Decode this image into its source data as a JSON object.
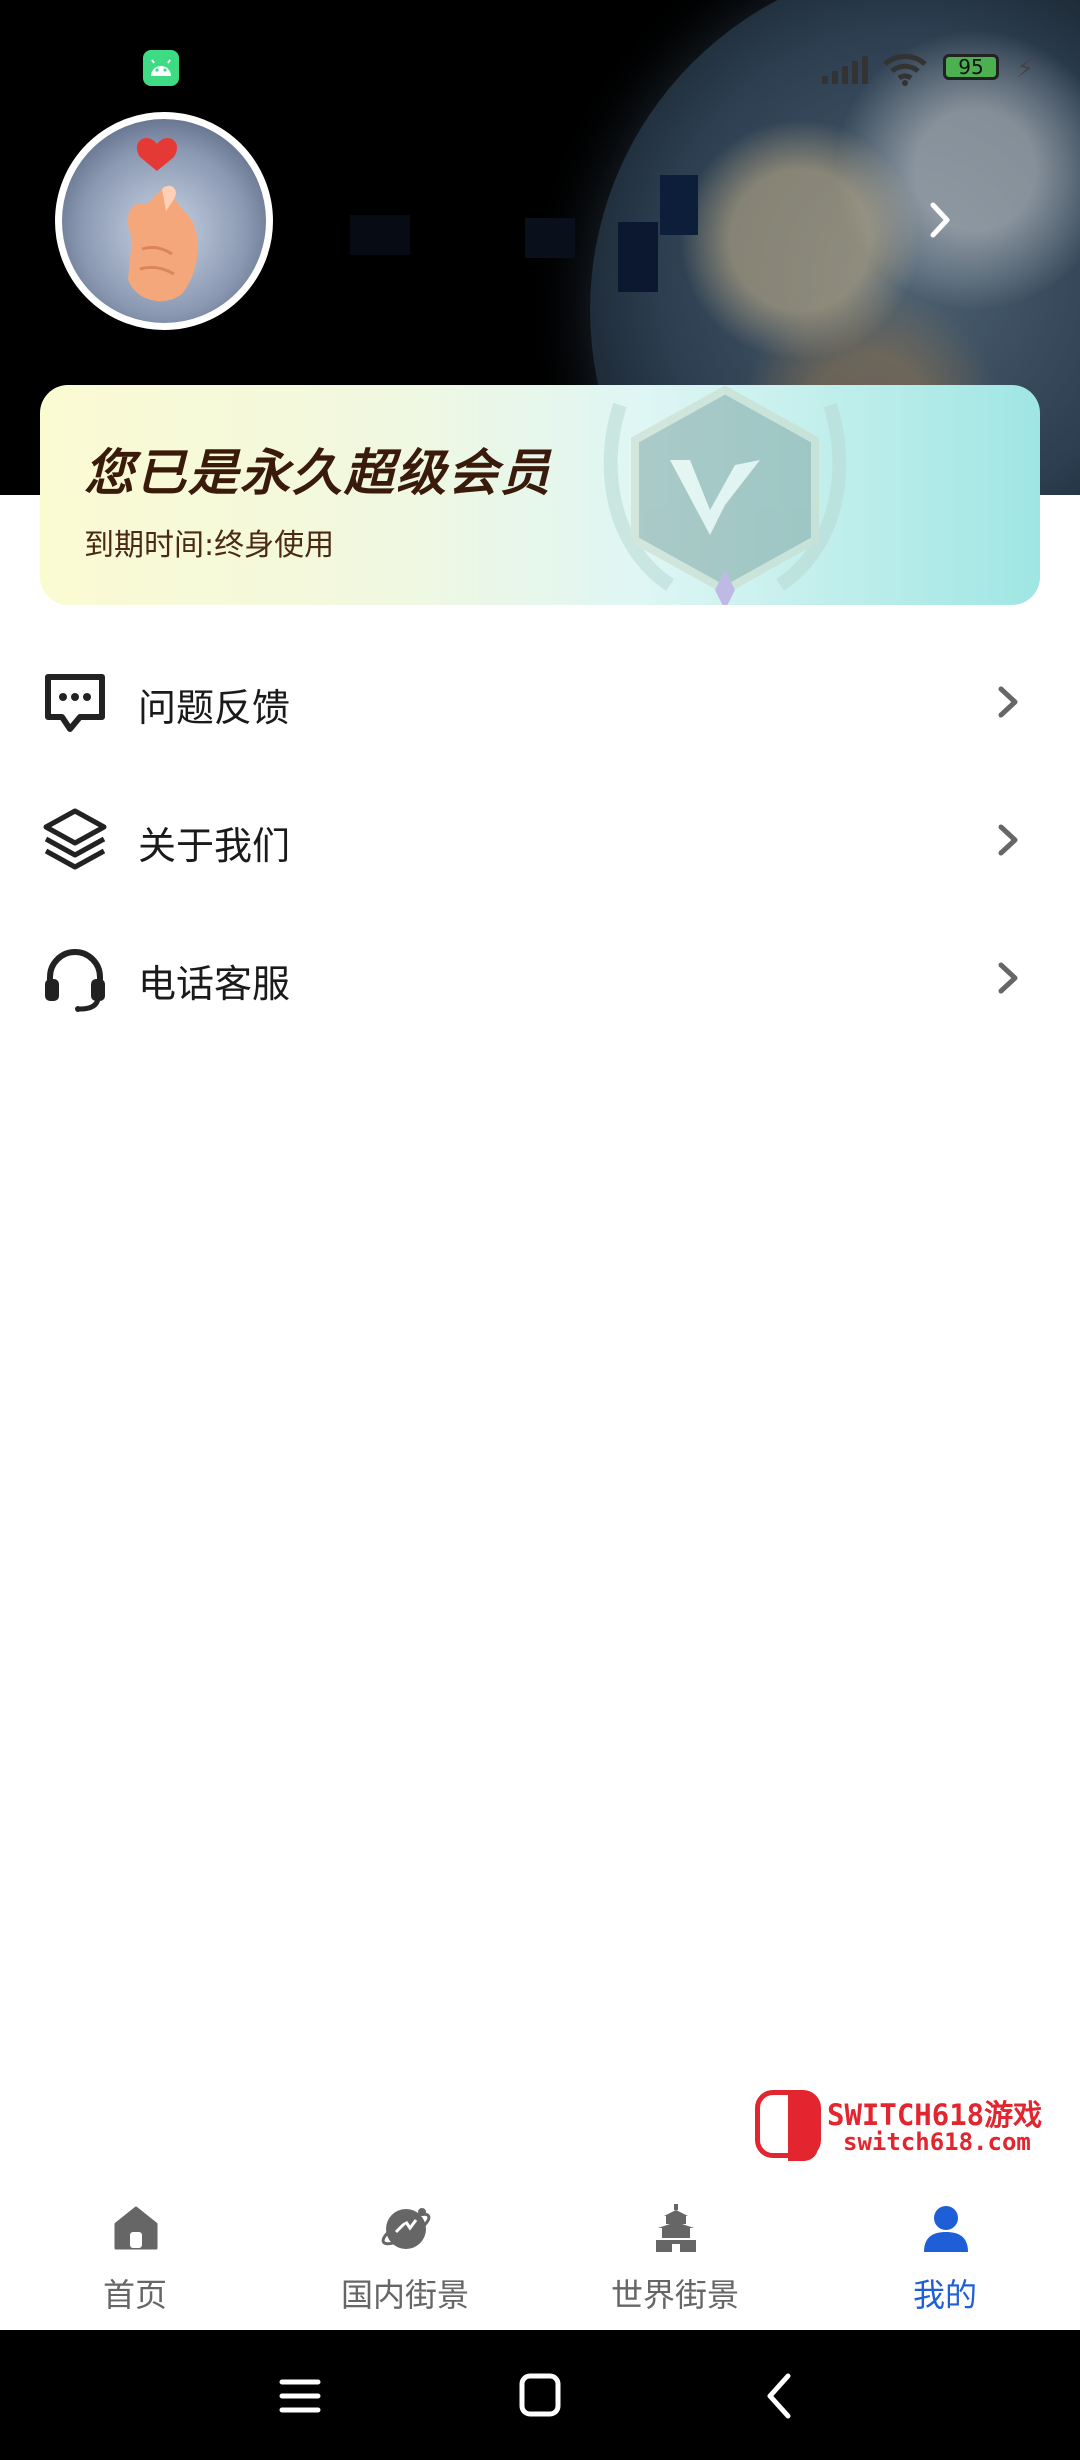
{
  "status_bar": {
    "battery_level": "95",
    "icons": [
      "android-notification-icon",
      "signal-icon",
      "wifi-icon",
      "battery-icon",
      "charging-icon"
    ]
  },
  "profile": {
    "avatar_icon": "finger-heart-avatar",
    "chevron_icon": "chevron-right-icon"
  },
  "vip": {
    "title": "您已是永久超级会员",
    "expiry": "到期时间:终身使用"
  },
  "menu": [
    {
      "label": "问题反馈",
      "icon": "chat-dots-icon"
    },
    {
      "label": "关于我们",
      "icon": "layers-icon"
    },
    {
      "label": "电话客服",
      "icon": "headset-icon"
    }
  ],
  "watermark": {
    "title": "SWITCH618游戏",
    "url": "switch618.com"
  },
  "tabs": [
    {
      "label": "首页",
      "icon": "home-icon"
    },
    {
      "label": "国内街景",
      "icon": "planet-icon"
    },
    {
      "label": "世界街景",
      "icon": "temple-icon"
    },
    {
      "label": "我的",
      "icon": "user-icon",
      "active": true
    }
  ],
  "colors": {
    "accent": "#1e5fd8",
    "tab_inactive": "#666666",
    "vip_text": "#3a1a0a"
  },
  "system_nav": [
    "menu-icon",
    "home-square-icon",
    "back-icon"
  ]
}
